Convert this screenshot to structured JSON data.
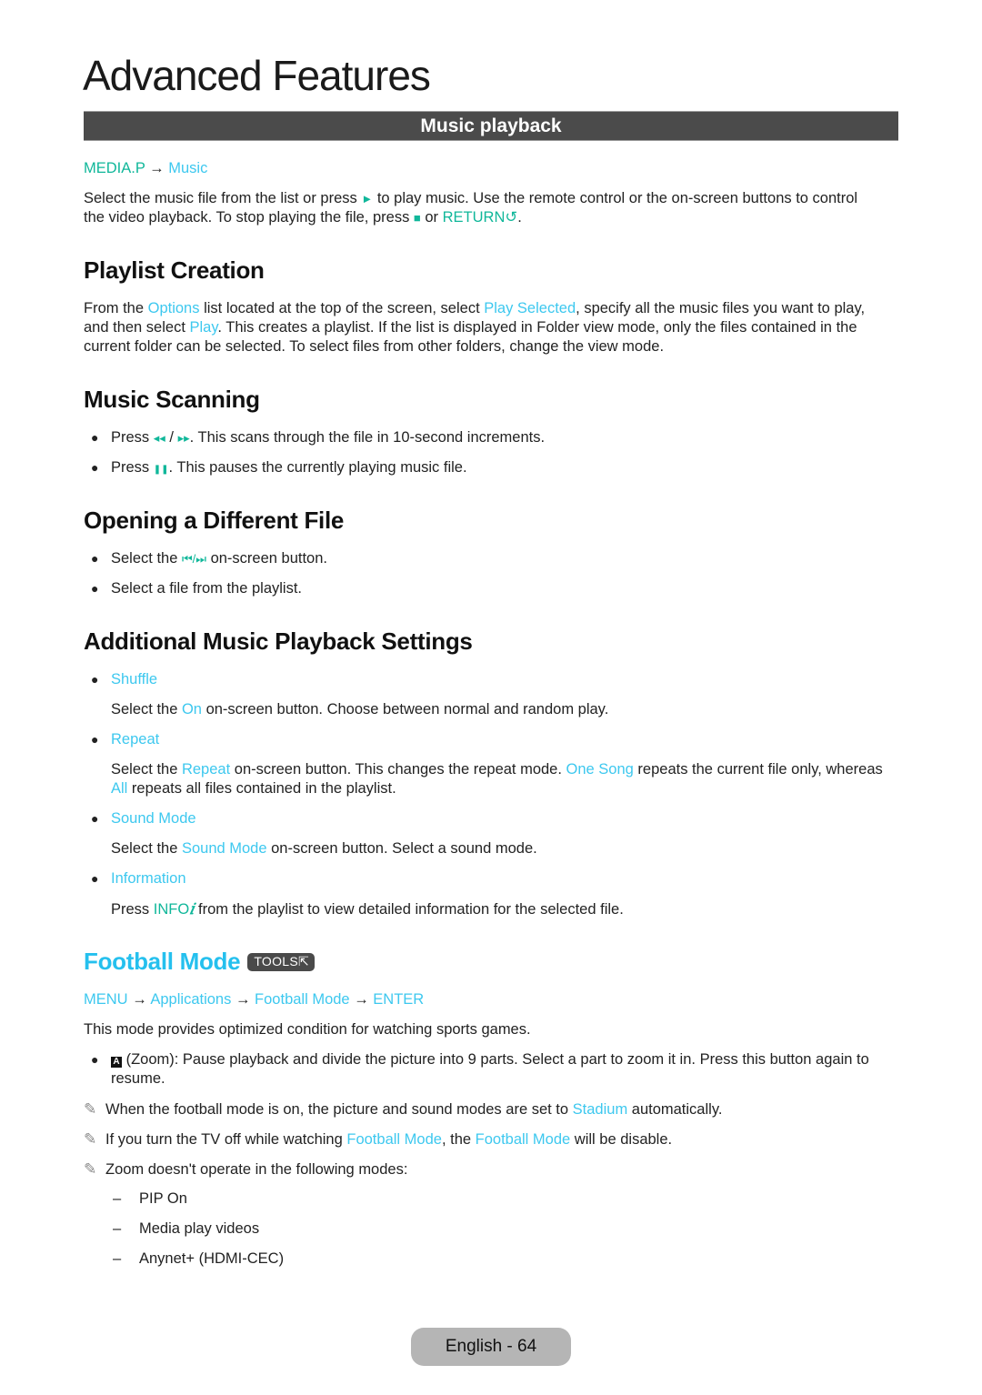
{
  "page": {
    "title": "Advanced Features",
    "banner": "Music playback",
    "footer": "English - 64"
  },
  "colors": {
    "link_cyan": "#3dc8ef",
    "key_teal": "#10b79a",
    "heading_cyan": "#25c0ee",
    "banner_bg": "#4b4b4b",
    "footer_bg": "#b5b5b5"
  },
  "intro": {
    "path": {
      "root": "MEDIA.P",
      "arrow": "→",
      "leaf": "Music"
    },
    "text1": "Select the music file from the list or press ",
    "play_icon": "►",
    "text2": " to play music. Use the remote control or the on-screen buttons to control",
    "text3": "the video playback. To stop playing the file, press ",
    "stop_icon": "■",
    "text4": " or ",
    "return_key": "RETURN",
    "return_icon": "↺",
    "text5": "."
  },
  "playlist": {
    "heading": "Playlist Creation",
    "t1": "From the ",
    "options": "Options",
    "t2": " list located at the top of the screen, select ",
    "play_selected": "Play Selected",
    "t3": ", specify all the music files you want to play,",
    "t4": "and then select ",
    "play": "Play",
    "t5": ". This creates a playlist. If the list is displayed in Folder view mode, only the files contained in the",
    "t6": "current folder can be selected. To select files from other folders, change the view mode."
  },
  "scanning": {
    "heading": "Music Scanning",
    "items": [
      {
        "pre": "Press ",
        "icon1": "◂◂",
        "sep": " / ",
        "icon2": "▸▸",
        "post": ". This scans through the file in 10-second increments."
      },
      {
        "pre": "Press ",
        "icon1": "❚❚",
        "post": ". This pauses the currently playing music file."
      }
    ]
  },
  "different_file": {
    "heading": "Opening a Different File",
    "items": [
      {
        "pre": "Select the ",
        "icon": "⏮/⏭",
        "post": " on-screen button."
      },
      {
        "text": "Select a file from the playlist."
      }
    ]
  },
  "settings": {
    "heading": "Additional Music Playback Settings",
    "shuffle": {
      "label": "Shuffle",
      "t1": "Select the ",
      "on": "On",
      "t2": " on-screen button. Choose between normal and random play."
    },
    "repeat": {
      "label": "Repeat",
      "t1": "Select the ",
      "repeat": "Repeat",
      "t2": " on-screen button. This changes the repeat mode. ",
      "one_song": "One Song",
      "t3": " repeats the current file only, whereas",
      "all": "All",
      "t4": " repeats all files contained in the playlist."
    },
    "sound_mode": {
      "label": "Sound Mode",
      "t1": "Select the ",
      "sound_mode": "Sound Mode",
      "t2": " on-screen button. Select a sound mode."
    },
    "information": {
      "label": "Information",
      "t1": "Press ",
      "info": "INFO",
      "info_icon": "𝑖",
      "t2": " from the playlist to view detailed information for the selected file."
    }
  },
  "football": {
    "heading": "Football Mode",
    "tools_badge": "TOOLS",
    "tools_icon": "⇱",
    "path": [
      "MENU",
      "Applications",
      "Football Mode",
      "ENTER"
    ],
    "arrow": "→",
    "intro": "This mode provides optimized condition for watching sports games.",
    "zoom_key": "A",
    "zoom_t1": " (Zoom): Pause playback and divide the picture into 9 parts. Select a part to zoom it in. Press this button again to",
    "zoom_t2": "resume.",
    "note_icon": "✎",
    "note1": {
      "t1": "When the football mode is on, the picture and sound modes are set to ",
      "stadium": "Stadium",
      "t2": " automatically."
    },
    "note2": {
      "t1": "If you turn the TV off while watching ",
      "fm1": "Football Mode",
      "t2": ", the ",
      "fm2": "Football Mode",
      "t3": " will be disable."
    },
    "note3": "Zoom doesn't operate in the following modes:",
    "dash": "–",
    "modes": [
      "PIP On",
      "Media play videos",
      "Anynet+ (HDMI-CEC)"
    ]
  }
}
